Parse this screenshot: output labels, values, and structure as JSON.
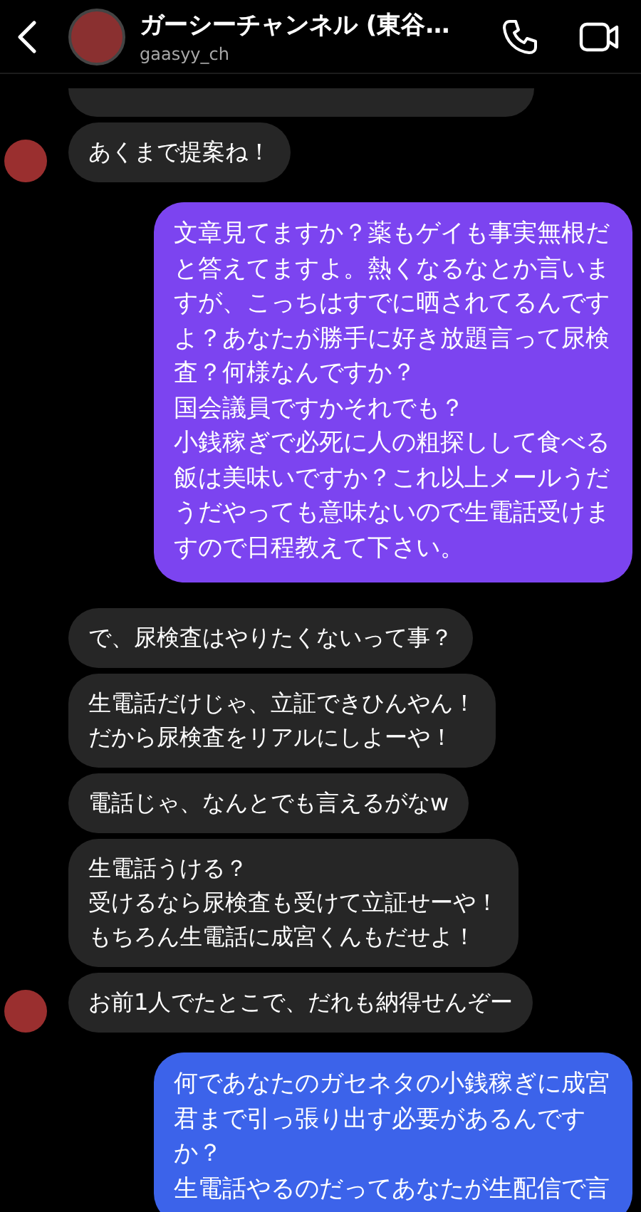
{
  "header": {
    "title": "ガーシーチャンネル (東谷…",
    "username": "gaasyy_ch"
  },
  "messages": [
    {
      "kind": "cut-off"
    },
    {
      "kind": "received",
      "lines": [
        "あくまで提案ね！"
      ],
      "show_avatar": true
    },
    {
      "kind": "sent",
      "color": "#7c44f0",
      "lines": [
        "文章見てますか？薬もゲイも事実無根だと答えてますよ。熱くなるなとか言いますが、こっちはすでに晒されてるんですよ？あなたが勝手に好き放題言って尿検査？何様なんですか？",
        "国会議員ですかそれでも？",
        "小銭稼ぎで必死に人の粗探しして食べる飯は美味いですか？これ以上メールうだうだやっても意味ないので生電話受けますので日程教えて下さい。"
      ]
    },
    {
      "kind": "received",
      "lines": [
        "で、尿検査はやりたくないって事？"
      ],
      "show_avatar": false
    },
    {
      "kind": "received",
      "lines": [
        "生電話だけじゃ、立証できひんやん！",
        "だから尿検査をリアルにしよーや！"
      ],
      "show_avatar": false
    },
    {
      "kind": "received",
      "lines": [
        "電話じゃ、なんとでも言えるがなw"
      ],
      "show_avatar": false
    },
    {
      "kind": "received",
      "lines": [
        "生電話うける？",
        "受けるなら尿検査も受けて立証せーや！",
        "もちろん生電話に成宮くんもだせよ！"
      ],
      "show_avatar": false
    },
    {
      "kind": "received",
      "lines": [
        "お前1人でたとこで、だれも納得せんぞー"
      ],
      "show_avatar": true
    },
    {
      "kind": "sent",
      "color": "#3c63ea",
      "lines": [
        "何であなたのガセネタの小銭稼ぎに成宮君まで引っ張り出す必要があるんですか？",
        "生電話やるのだってあなたが生配信で言"
      ]
    }
  ]
}
